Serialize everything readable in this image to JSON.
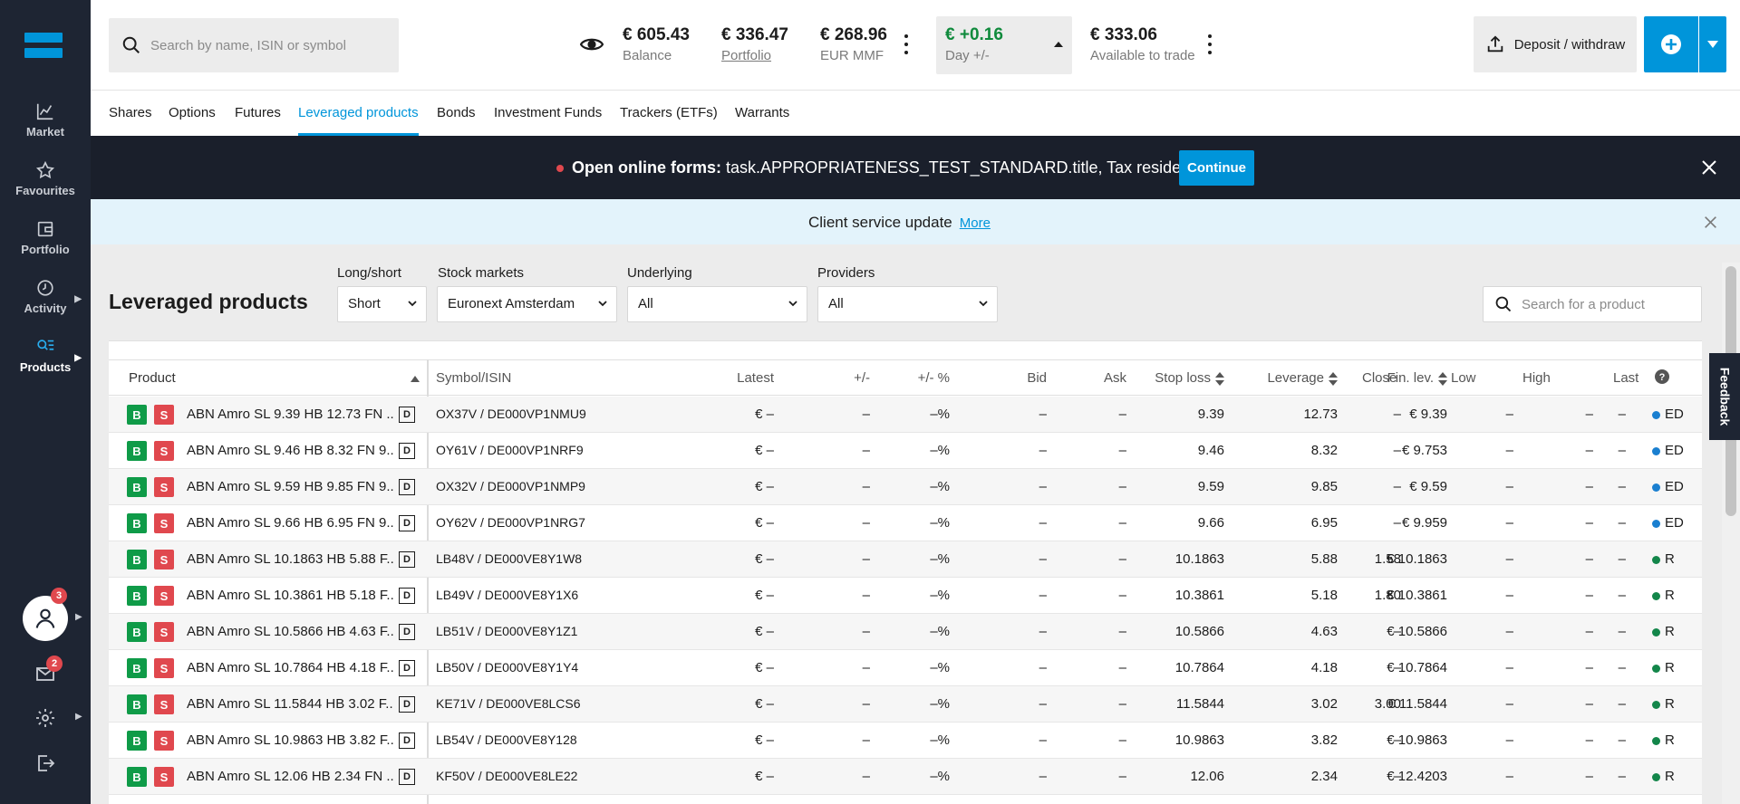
{
  "sidebar": {
    "items": [
      {
        "label": "Market",
        "icon": "chart-line-icon"
      },
      {
        "label": "Favourites",
        "icon": "star-icon"
      },
      {
        "label": "Portfolio",
        "icon": "wallet-icon"
      },
      {
        "label": "Activity",
        "icon": "clock-icon"
      },
      {
        "label": "Products",
        "icon": "search-list-icon"
      }
    ],
    "user_badge": "3",
    "mail_badge": "2"
  },
  "header": {
    "search_placeholder": "Search by name, ISIN or symbol",
    "balance_value": "€ 605.43",
    "balance_label": "Balance",
    "portfolio_value": "€ 336.47",
    "portfolio_label": "Portfolio",
    "mmf_value": "€ 268.96",
    "mmf_label": "EUR MMF",
    "day_value": "€ +0.16",
    "day_label": "Day +/-",
    "available_value": "€ 333.06",
    "available_label": "Available to trade",
    "deposit_label": "Deposit / withdraw"
  },
  "tabs": [
    "Shares",
    "Options",
    "Futures",
    "Leveraged products",
    "Bonds",
    "Investment Funds",
    "Trackers (ETFs)",
    "Warrants"
  ],
  "forms_banner": {
    "bold": "Open online forms:",
    "text": " task.APPROPRIATENESS_TEST_STANDARD.title, Tax residency ...",
    "button": "Continue"
  },
  "service_banner": {
    "text": "Client service update",
    "link": "More"
  },
  "filters": {
    "heading": "Leveraged products",
    "long_short_label": "Long/short",
    "long_short_value": "Short",
    "markets_label": "Stock markets",
    "markets_value": "Euronext Amsterdam",
    "underlying_label": "Underlying",
    "underlying_value": "All",
    "providers_label": "Providers",
    "providers_value": "All",
    "product_search_placeholder": "Search for a product"
  },
  "table": {
    "columns": [
      "Product",
      "Symbol/ISIN",
      "Latest",
      "+/-",
      "+/- %",
      "Bid",
      "Ask",
      "Stop loss",
      "Leverage",
      "Fin. lev.",
      "Close",
      "Low",
      "High",
      "Last"
    ],
    "buy_label": "B",
    "sell_label": "S",
    "d_label": "D",
    "rows": [
      {
        "product": "ABN Amro SL 9.39 HB 12.73 FN ...",
        "symbol": "OX37V / DE000VP1NMU9",
        "latest": "€ –",
        "chg": "–",
        "chgpct": "–%",
        "bid": "–",
        "ask": "–",
        "stop": "9.39",
        "lev": "12.73",
        "fin": "€ 9.39",
        "close": "–",
        "low": "–",
        "high": "–",
        "last": "–",
        "mkt": "ED",
        "mkt_color": "#1a7fd0"
      },
      {
        "product": "ABN Amro SL 9.46 HB 8.32 FN 9....",
        "symbol": "OY61V / DE000VP1NRF9",
        "latest": "€ –",
        "chg": "–",
        "chgpct": "–%",
        "bid": "–",
        "ask": "–",
        "stop": "9.46",
        "lev": "8.32",
        "fin": "€ 9.753",
        "close": "–",
        "low": "–",
        "high": "–",
        "last": "–",
        "mkt": "ED",
        "mkt_color": "#1a7fd0"
      },
      {
        "product": "ABN Amro SL 9.59 HB 9.85 FN 9....",
        "symbol": "OX32V / DE000VP1NMP9",
        "latest": "€ –",
        "chg": "–",
        "chgpct": "–%",
        "bid": "–",
        "ask": "–",
        "stop": "9.59",
        "lev": "9.85",
        "fin": "€ 9.59",
        "close": "–",
        "low": "–",
        "high": "–",
        "last": "–",
        "mkt": "ED",
        "mkt_color": "#1a7fd0"
      },
      {
        "product": "ABN Amro SL 9.66 HB 6.95 FN 9....",
        "symbol": "OY62V / DE000VP1NRG7",
        "latest": "€ –",
        "chg": "–",
        "chgpct": "–%",
        "bid": "–",
        "ask": "–",
        "stop": "9.66",
        "lev": "6.95",
        "fin": "€ 9.959",
        "close": "–",
        "low": "–",
        "high": "–",
        "last": "–",
        "mkt": "ED",
        "mkt_color": "#1a7fd0"
      },
      {
        "product": "ABN Amro SL 10.1863 HB 5.88 F...",
        "symbol": "LB48V / DE000VE8Y1W8",
        "latest": "€ –",
        "chg": "–",
        "chgpct": "–%",
        "bid": "–",
        "ask": "–",
        "stop": "10.1863",
        "lev": "5.88",
        "fin": "€ 10.1863",
        "close": "1.58",
        "low": "–",
        "high": "–",
        "last": "–",
        "mkt": "R",
        "mkt_color": "#13864a"
      },
      {
        "product": "ABN Amro SL 10.3861 HB 5.18 F...",
        "symbol": "LB49V / DE000VE8Y1X6",
        "latest": "€ –",
        "chg": "–",
        "chgpct": "–%",
        "bid": "–",
        "ask": "–",
        "stop": "10.3861",
        "lev": "5.18",
        "fin": "€ 10.3861",
        "close": "1.80",
        "low": "–",
        "high": "–",
        "last": "–",
        "mkt": "R",
        "mkt_color": "#13864a"
      },
      {
        "product": "ABN Amro SL 10.5866 HB 4.63 F...",
        "symbol": "LB51V / DE000VE8Y1Z1",
        "latest": "€ –",
        "chg": "–",
        "chgpct": "–%",
        "bid": "–",
        "ask": "–",
        "stop": "10.5866",
        "lev": "4.63",
        "fin": "€ 10.5866",
        "close": "–",
        "low": "–",
        "high": "–",
        "last": "–",
        "mkt": "R",
        "mkt_color": "#13864a"
      },
      {
        "product": "ABN Amro SL 10.7864 HB 4.18 F...",
        "symbol": "LB50V / DE000VE8Y1Y4",
        "latest": "€ –",
        "chg": "–",
        "chgpct": "–%",
        "bid": "–",
        "ask": "–",
        "stop": "10.7864",
        "lev": "4.18",
        "fin": "€ 10.7864",
        "close": "–",
        "low": "–",
        "high": "–",
        "last": "–",
        "mkt": "R",
        "mkt_color": "#13864a"
      },
      {
        "product": "ABN Amro SL 11.5844 HB 3.02 F...",
        "symbol": "KE71V / DE000VE8LCS6",
        "latest": "€ –",
        "chg": "–",
        "chgpct": "–%",
        "bid": "–",
        "ask": "–",
        "stop": "11.5844",
        "lev": "3.02",
        "fin": "€ 11.5844",
        "close": "3.00",
        "low": "–",
        "high": "–",
        "last": "–",
        "mkt": "R",
        "mkt_color": "#13864a"
      },
      {
        "product": "ABN Amro SL 10.9863 HB 3.82 F...",
        "symbol": "LB54V / DE000VE8Y128",
        "latest": "€ –",
        "chg": "–",
        "chgpct": "–%",
        "bid": "–",
        "ask": "–",
        "stop": "10.9863",
        "lev": "3.82",
        "fin": "€ 10.9863",
        "close": "–",
        "low": "–",
        "high": "–",
        "last": "–",
        "mkt": "R",
        "mkt_color": "#13864a"
      },
      {
        "product": "ABN Amro SL 12.06 HB 2.34 FN ...",
        "symbol": "KF50V / DE000VE8LE22",
        "latest": "€ –",
        "chg": "–",
        "chgpct": "–%",
        "bid": "–",
        "ask": "–",
        "stop": "12.06",
        "lev": "2.34",
        "fin": "€ 12.4203",
        "close": "–",
        "low": "–",
        "high": "–",
        "last": "–",
        "mkt": "R",
        "mkt_color": "#13864a"
      }
    ]
  },
  "feedback_label": "Feedback",
  "colors": {
    "accent": "#0095da",
    "sidebar": "#1e2533",
    "buy": "#0f9b48",
    "sell": "#e0484e",
    "positive": "#0f8a3c"
  }
}
